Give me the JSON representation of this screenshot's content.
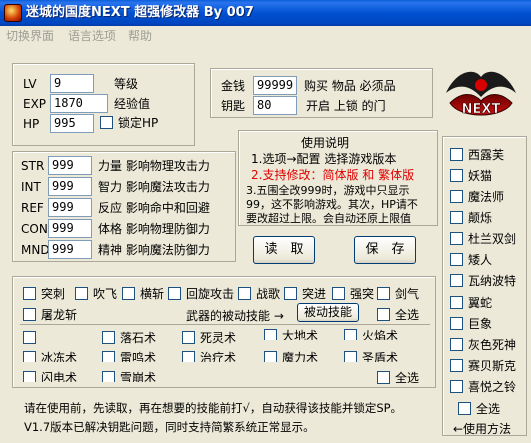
{
  "window": {
    "title": "迷城的国度NEXT 超强修改器 By 007"
  },
  "menu": [
    "切换界面",
    "语言选项",
    "帮助"
  ],
  "stats": {
    "lv": {
      "label": "LV",
      "value": "9",
      "desc": "等级"
    },
    "exp": {
      "label": "EXP",
      "value": "1870",
      "desc": "经验值"
    },
    "hp": {
      "label": "HP",
      "value": "995",
      "lock_label": "锁定HP"
    }
  },
  "money": {
    "gold": {
      "label": "金钱",
      "value": "99999",
      "desc": "购买 物品 必须品"
    },
    "key": {
      "label": "钥匙",
      "value": "80",
      "desc": "开启 上锁 的门"
    }
  },
  "instructions": {
    "title": "使用说明",
    "line1": "1.选项→配置 选择游戏版本",
    "line2": "2.支持修改：简体版 和 繁体版",
    "line3a": "3.五围全改999时，游戏中只显示",
    "line3b": "99，这不影响游戏。其次，HP请不",
    "line3c": "要改超过上限。会自动还原上限值"
  },
  "attributes": [
    {
      "label": "STR",
      "value": "999",
      "desc": "力量 影响物理攻击力"
    },
    {
      "label": "INT",
      "value": "999",
      "desc": "智力 影响魔法攻击力"
    },
    {
      "label": "REF",
      "value": "999",
      "desc": "反应 影响命中和回避"
    },
    {
      "label": "CON",
      "value": "999",
      "desc": "体格 影响物理防御力"
    },
    {
      "label": "MND",
      "value": "999",
      "desc": "精神 影响魔法防御力"
    }
  ],
  "buttons": {
    "read": "读　取",
    "save": "保　存",
    "passive": "被动技能"
  },
  "weapon_skills_row1": [
    "突刺",
    "吹飞",
    "横斩",
    "回旋攻击",
    "战歌",
    "突进",
    "强突",
    "剑气"
  ],
  "weapon_skills_row2": [
    "屠龙斩"
  ],
  "passive_label": "武器的被动技能 →",
  "select_all": "全选",
  "passive_skills": [
    "落石术",
    "死灵术",
    "大地术",
    "火焰术",
    "冰冻术",
    "雷鸣术",
    "治疗术",
    "魔力术",
    "圣盾术",
    "闪电术",
    "雪崩术"
  ],
  "footer": {
    "line1": "请在使用前，先读取，再在想要的技能前打√，自动获得该技能并锁定SP。",
    "line2": "V1.7版本已解决钥匙问题，同时支持简繁系统正常显示。"
  },
  "characters": [
    "西露芙",
    "妖猫",
    "魔法师",
    "颠烁",
    "杜兰双剑",
    "矮人",
    "瓦纳波特",
    "翼蛇",
    "巨象",
    "灰色死神",
    "赛贝斯克",
    "喜悦之铃"
  ],
  "right_select_all": "全选",
  "usage_link": "←使用方法",
  "logo_text": "NEXT"
}
